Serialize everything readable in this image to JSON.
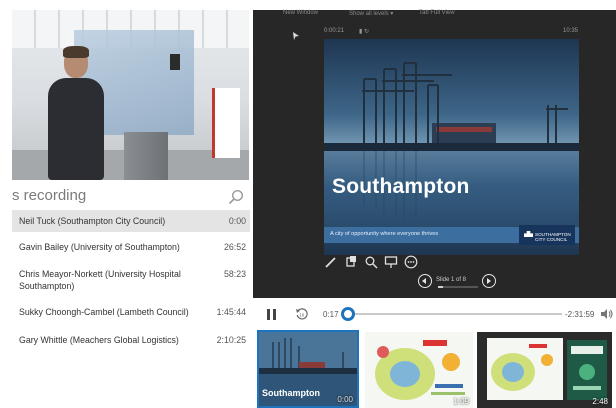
{
  "camera": {},
  "index": {
    "title": "s recording",
    "items": [
      {
        "name": "Neil Tuck (Southampton City Council)",
        "time": "0:00",
        "active": true
      },
      {
        "name": "Gavin Bailey (University of Southampton)",
        "time": "26:52",
        "active": false
      },
      {
        "name": "Chris Meayor-Norkett (University Hospital Southampton)",
        "time": "58:23",
        "active": false
      },
      {
        "name": "Sukky Choongh-Cambel (Lambeth Council)",
        "time": "1:45:44",
        "active": false
      },
      {
        "name": "Gary Whittle (Meachers Global Logistics)",
        "time": "2:10:25",
        "active": false
      }
    ]
  },
  "viewer": {
    "toolbar": [
      "New Window",
      "Show all levels ▾",
      "Tab Full View"
    ],
    "meta_left": "0:00:21",
    "meta_right": "10:35",
    "slide": {
      "title": "Southampton",
      "tagline": "A city of opportunity where everyone thrives",
      "logo": "SOUTHAMPTON CITY COUNCIL"
    },
    "tools": [
      "pen-icon",
      "eraser-icon",
      "zoom-icon",
      "screen-icon",
      "more-icon"
    ],
    "slide_counter": "Slide 1 of 8",
    "slide_progress": 0.125
  },
  "transport": {
    "time_current": "0:17",
    "time_remaining": "-2:31:59",
    "progress": 0.005
  },
  "thumbnails": [
    {
      "title": "Southampton",
      "time": "0:00",
      "active": true
    },
    {
      "title": "",
      "time": "1:09",
      "active": false
    },
    {
      "title": "",
      "time": "2:48",
      "active": false
    }
  ],
  "colors": {
    "accent": "#1e73be",
    "dark": "#272727"
  }
}
